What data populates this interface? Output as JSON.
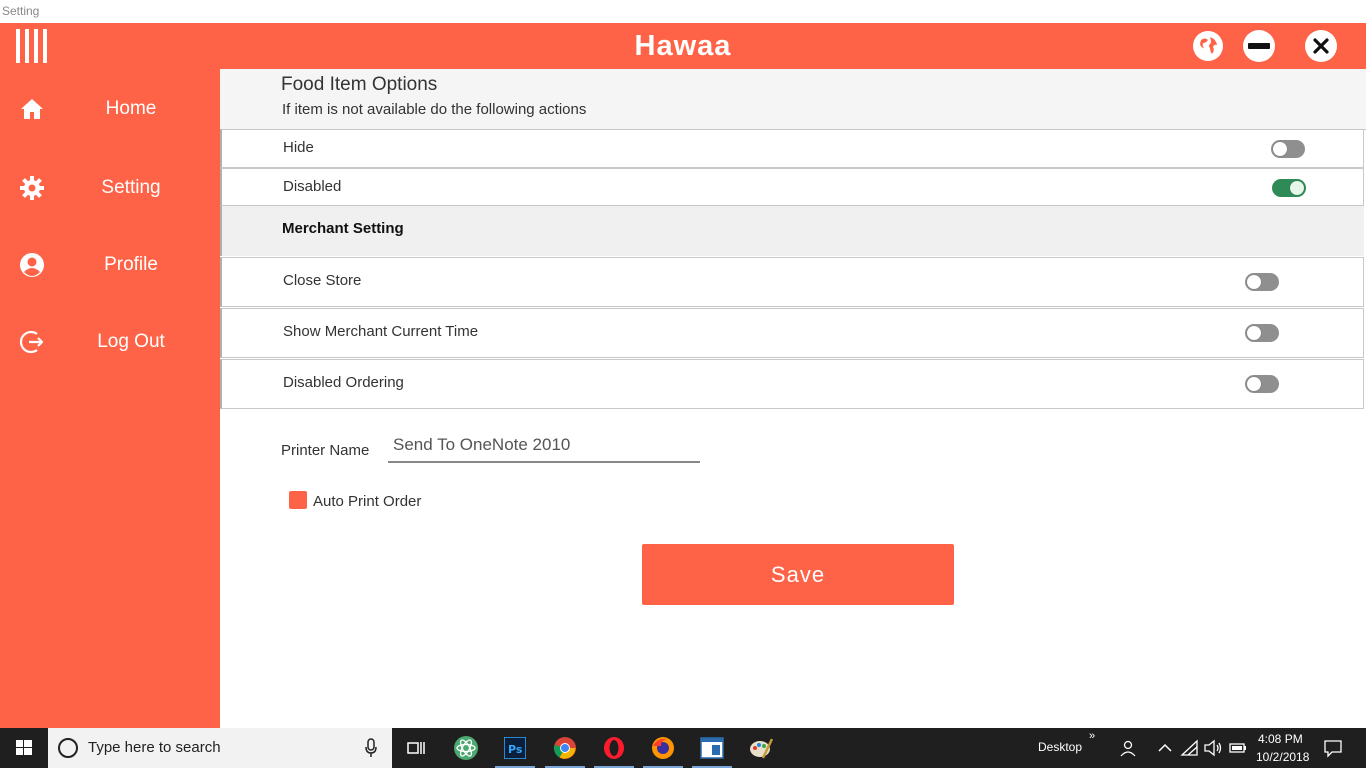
{
  "window": {
    "title": "Setting"
  },
  "header": {
    "app_title": "Hawaa"
  },
  "sidebar": {
    "items": [
      {
        "label": "Home",
        "icon": "home-icon"
      },
      {
        "label": "Setting",
        "icon": "gear-icon"
      },
      {
        "label": "Profile",
        "icon": "user-circle-icon"
      },
      {
        "label": "Log Out",
        "icon": "logout-icon"
      }
    ]
  },
  "food_options": {
    "title": "Food Item Options",
    "subtitle": "If item is not available do the following actions",
    "rows": [
      {
        "label": "Hide",
        "enabled": false
      },
      {
        "label": "Disabled",
        "enabled": true
      }
    ]
  },
  "merchant": {
    "title": "Merchant Setting",
    "rows": [
      {
        "label": "Close Store",
        "enabled": false
      },
      {
        "label": "Show Merchant Current Time",
        "enabled": false
      },
      {
        "label": "Disabled Ordering",
        "enabled": false
      }
    ]
  },
  "printer": {
    "label": "Printer Name",
    "value": "Send To OneNote 2010"
  },
  "auto_print": {
    "label": "Auto Print Order",
    "checked": true
  },
  "save_button": {
    "label": "Save"
  },
  "taskbar": {
    "search_placeholder": "Type here to search",
    "desktop_label": "Desktop",
    "chevron": "»",
    "time": "4:08 PM",
    "date": "10/2/2018",
    "apps": [
      "task-view",
      "atom",
      "photoshop",
      "chrome",
      "opera",
      "firefox",
      "app-window",
      "paint"
    ]
  },
  "colors": {
    "brand": "#ff6347",
    "toggle_on": "#2e8b57",
    "toggle_off": "#8f8f8f"
  }
}
